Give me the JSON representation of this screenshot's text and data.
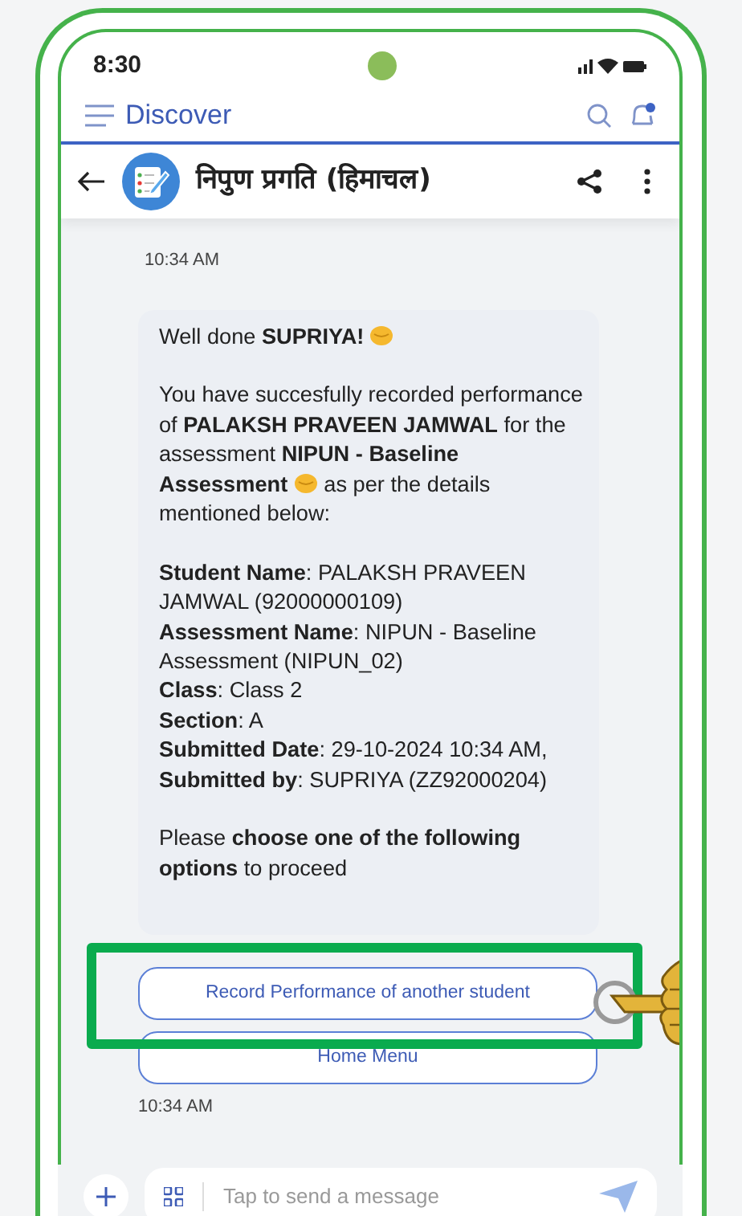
{
  "status_bar": {
    "time": "8:30"
  },
  "app_bar": {
    "title": "Discover"
  },
  "chat_header": {
    "title": "निपुण प्रगति (हिमाचल)"
  },
  "messages": [
    {
      "time": "10:34 AM"
    }
  ],
  "bubble": {
    "paragraphs": [
      [
        {
          "kind": "text",
          "text": "Well done **SUPRIYA!**"
        },
        {
          "kind": "emoji"
        }
      ],
      [
        {
          "kind": "text",
          "text": "You have succesfully recorded performance of **PALAKSH PRAVEEN JAMWAL** for the assessment **NIPUN - Baseline Assessment**"
        },
        {
          "kind": "emoji"
        },
        {
          "kind": "text",
          "text": " as per the details mentioned below:"
        }
      ]
    ],
    "details": [
      "**Student Name**: PALAKSH PRAVEEN JAMWAL (92000000109)",
      "**Assessment Name**: NIPUN - Baseline Assessment (NIPUN_02)",
      "**Class**: Class 2",
      "**Section**: A",
      "**Submitted Date**: 29-10-2024 10:34 AM,",
      "**Submitted by**: SUPRIYA (ZZ92000204)"
    ],
    "closing": "Please **choose one of the following options** to proceed"
  },
  "buttons": [
    {
      "label": "Record Performance of another student",
      "highlighted": true
    },
    {
      "label": "Home Menu",
      "highlighted": false
    }
  ],
  "footer_time": "10:34 AM",
  "composer": {
    "placeholder": "Tap to send a message"
  }
}
